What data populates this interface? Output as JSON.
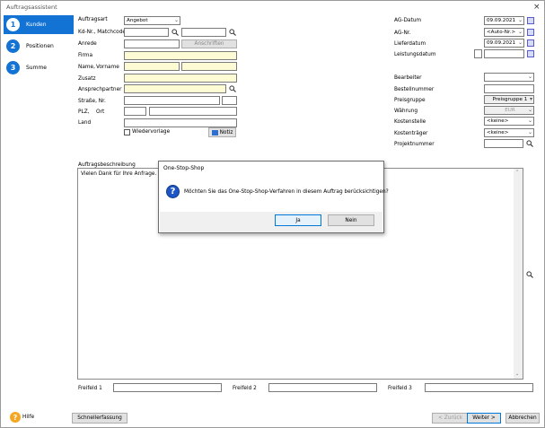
{
  "window": {
    "title": "Auftragsassistent",
    "close": "×"
  },
  "steps": [
    {
      "num": "1",
      "label": "Kunden"
    },
    {
      "num": "2",
      "label": "Positionen"
    },
    {
      "num": "3",
      "label": "Summe"
    }
  ],
  "form": {
    "auftragsart_label": "Auftragsart",
    "auftragsart_value": "Angebot",
    "kdnr_label": "Kd-Nr., Matchcode",
    "anrede_label": "Anrede",
    "anschriften_btn": "Anschriften",
    "firma_label": "Firma",
    "name_label": "Name,",
    "vorname_label": "Vorname",
    "zusatz_label": "Zusatz",
    "ansprech_label": "Ansprechpartner",
    "strasse_label": "Straße, Nr.",
    "plz_label": "PLZ,",
    "ort_label": "Ort",
    "land_label": "Land",
    "wiedervorlage_label": "Wiedervorlage",
    "notiz_btn": "Notiz"
  },
  "right": {
    "agdatum_label": "AG-Datum",
    "agdatum_value": "09.09.2021",
    "agnr_label": "AG-Nr.",
    "agnr_value": "<Auto-Nr.>",
    "liefer_label": "Lieferdatum",
    "liefer_value": "09.09.2021",
    "leistung_label": "Leistungsdatum",
    "bearbeiter_label": "Bearbeiter",
    "bestell_label": "Bestellnummer",
    "preis_label": "Preisgruppe",
    "preis_value": "Preisgruppe 1",
    "waehrung_label": "Währung",
    "waehrung_value": "EUR",
    "kstelle_label": "Kostenstelle",
    "kstelle_value": "<keine>",
    "ktraeger_label": "Kostenträger",
    "ktraeger_value": "<keine>",
    "projekt_label": "Projektnummer"
  },
  "desc": {
    "label": "Auftragsbeschreibung",
    "text": "Vielen Dank für Ihre Anfrage. Nach"
  },
  "freifelder": [
    "Freifeld 1",
    "Freifeld 2",
    "Freifeld 3"
  ],
  "dialog": {
    "title": "One-Stop-Shop",
    "message": "Möchten Sie das One-Stop-Shop-Verfahren in diesem Auftrag berücksichtigen?",
    "yes": "Ja",
    "no": "Nein"
  },
  "footer": {
    "help": "Hilfe",
    "schnell": "Schnellerfassung",
    "back": "< Zurück",
    "next": "Weiter >",
    "cancel": "Abbrechen"
  }
}
